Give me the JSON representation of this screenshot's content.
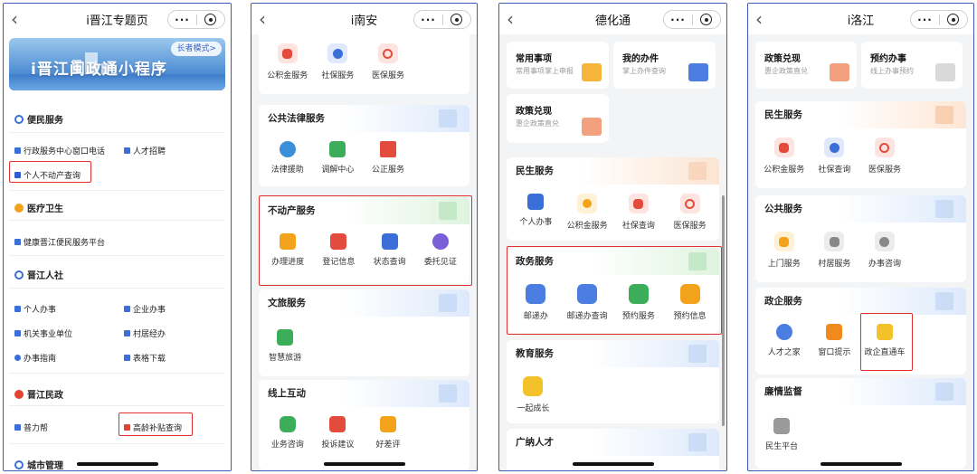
{
  "phone1": {
    "title": "i晋江专题页",
    "banner_text": "i晋江闽政通小程序",
    "elder_mode": "长者模式>",
    "sections": [
      {
        "name": "便民服务"
      },
      {
        "name": "医疗卫生"
      },
      {
        "name": "晋江人社"
      },
      {
        "name": "晋江民政"
      },
      {
        "name": "城市管理"
      }
    ],
    "items": {
      "hall_phone": "行政服务中心窗口电话",
      "talent": "人才招聘",
      "property": "个人不动产查询",
      "health_platform": "健康晋江便民服务平台",
      "personal": "个人办事",
      "enterprise": "企业办事",
      "institution": "机关事业单位",
      "village": "村居经办",
      "guide": "办事指南",
      "forms": "表格下载",
      "puli": "普力帮",
      "elder_subsidy": "高龄补贴查询"
    }
  },
  "phone2": {
    "title": "i南安",
    "top_items": [
      "公积金服务",
      "社保服务",
      "医保服务"
    ],
    "legal": {
      "title": "公共法律服务",
      "items": [
        "法律援助",
        "调解中心",
        "公正服务"
      ]
    },
    "realestate": {
      "title": "不动产服务",
      "items": [
        "办理进度",
        "登记信息",
        "状态查询",
        "委托见证"
      ]
    },
    "culture": {
      "title": "文旅服务",
      "items": [
        "智慧旅游"
      ]
    },
    "online": {
      "title": "线上互动",
      "items": [
        "业务咨询",
        "投诉建议",
        "好差评"
      ]
    }
  },
  "phone3": {
    "title": "德化通",
    "tiles": [
      {
        "title": "常用事项",
        "sub": "常用事项掌上申报"
      },
      {
        "title": "我的办件",
        "sub": "掌上办件查询"
      },
      {
        "title": "政策兑现",
        "sub": "惠企政策直兑"
      }
    ],
    "livelihood": {
      "title": "民生服务",
      "items": [
        "个人办事",
        "公积金服务",
        "社保查询",
        "医保服务"
      ]
    },
    "government": {
      "title": "政务服务",
      "items": [
        "邮递办",
        "邮递办查询",
        "预约服务",
        "预约信息"
      ]
    },
    "education": {
      "title": "教育服务",
      "items": [
        "一起成长"
      ]
    },
    "talent": {
      "title": "广纳人才"
    }
  },
  "phone4": {
    "title": "i洛江",
    "tiles": [
      {
        "title": "政策兑现",
        "sub": "惠企政策直兑"
      },
      {
        "title": "预约办事",
        "sub": "线上办事预约"
      }
    ],
    "livelihood": {
      "title": "民生服务",
      "items": [
        "公积金服务",
        "社保查询",
        "医保服务"
      ]
    },
    "public": {
      "title": "公共服务",
      "items": [
        "上门服务",
        "村居服务",
        "办事咨询"
      ]
    },
    "business": {
      "title": "政企服务",
      "items": [
        "人才之家",
        "窗口提示",
        "政企直通车"
      ]
    },
    "integrity": {
      "title": "廉情监督",
      "items": [
        "民生平台"
      ]
    }
  },
  "colors": {
    "highlight": "#e03030",
    "frame": "#3b5bb5",
    "accent_blue": "#3a6fd8"
  }
}
